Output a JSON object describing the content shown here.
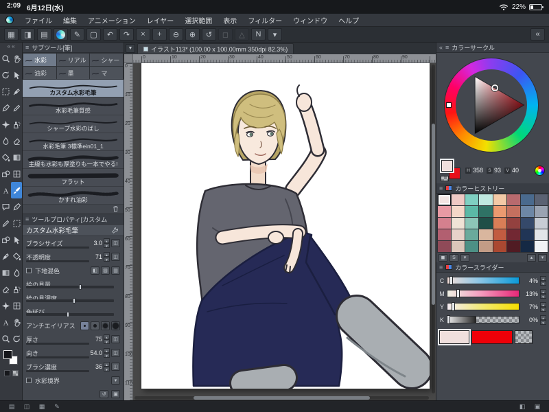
{
  "ui_glyphs": {
    "burger": "≡",
    "chevron": "«",
    "step_up": "▲",
    "step_down": "▼",
    "expand": "▾",
    "doc_menu": "▼"
  },
  "status_bar": {
    "time": "2:09",
    "date": "6月12日(水)",
    "battery": "22%"
  },
  "menu_bar": {
    "items": [
      "ファイル",
      "編集",
      "アニメーション",
      "レイヤー",
      "選択範囲",
      "表示",
      "フィルター",
      "ウィンドウ",
      "ヘルプ"
    ]
  },
  "toolbar": {
    "icons": [
      {
        "name": "workspace-grid-icon",
        "glyph": "▦"
      },
      {
        "name": "split-view-icon",
        "glyph": "◨"
      },
      {
        "name": "palette-dock-icon",
        "glyph": "▤"
      },
      {
        "name": "current-tool-swirl-icon",
        "glyph": "",
        "swirl": true
      },
      {
        "name": "stabilizer-icon",
        "glyph": "✎"
      },
      {
        "name": "new-page-icon",
        "glyph": "▢"
      },
      {
        "name": "undo-icon",
        "glyph": "↶"
      },
      {
        "name": "redo-icon",
        "glyph": "↷"
      },
      {
        "name": "clear-icon",
        "glyph": "×"
      },
      {
        "name": "move-canvas-icon",
        "glyph": "+"
      },
      {
        "name": "zoom-out-icon",
        "glyph": "⊖"
      },
      {
        "name": "zoom-in-icon",
        "glyph": "⊕"
      },
      {
        "name": "reset-rotate-icon",
        "glyph": "↺"
      },
      {
        "name": "transform-icon",
        "glyph": "◻",
        "disabled": true
      },
      {
        "name": "snap-icon",
        "glyph": "△",
        "disabled": true
      },
      {
        "name": "pressure-curve-icon",
        "glyph": "N"
      },
      {
        "name": "toolbar-menu-icon",
        "glyph": "▾"
      },
      {
        "name": "collapse-right-icon",
        "glyph": "«",
        "last": true
      }
    ]
  },
  "tools": {
    "chevron": "« «",
    "cells": [
      {
        "icon": "magnifier",
        "name": "zoom-tool"
      },
      {
        "icon": "hand",
        "name": "move-tool"
      },
      {
        "icon": "rotate",
        "name": "rotate-tool"
      },
      {
        "icon": "cursor",
        "name": "operation-tool"
      },
      {
        "icon": "lasso",
        "name": "selection-tool"
      },
      {
        "icon": "eyedropper",
        "name": "eyedropper-tool"
      },
      {
        "icon": "pen",
        "name": "pen-tool"
      },
      {
        "icon": "pencil",
        "name": "pencil-tool"
      },
      {
        "icon": "decoration",
        "name": "decoration-tool"
      },
      {
        "icon": "airbrush",
        "name": "airbrush-tool"
      },
      {
        "icon": "blend",
        "name": "blend-tool"
      },
      {
        "icon": "eraser",
        "name": "eraser-tool"
      },
      {
        "icon": "bucket",
        "name": "fill-tool"
      },
      {
        "icon": "gradient",
        "name": "gradient-tool"
      },
      {
        "icon": "shape",
        "name": "figure-tool"
      },
      {
        "icon": "frame",
        "name": "frame-tool"
      },
      {
        "icon": "text",
        "name": "text-tool"
      },
      {
        "icon": "brush",
        "name": "brush-tool",
        "selected": true
      },
      {
        "icon": "balloon",
        "name": "balloon-tool"
      },
      {
        "icon": "pen",
        "name": "line-correction-tool"
      },
      {
        "icon": "pencil",
        "name": "crayon-tool"
      },
      {
        "icon": "lasso",
        "name": "polyline-selection-tool"
      },
      {
        "icon": "shape",
        "name": "ruler-tool"
      },
      {
        "icon": "cursor",
        "name": "object-tool"
      },
      {
        "icon": "eyedropper",
        "name": "color-sample-tool"
      },
      {
        "icon": "bucket",
        "name": "close-fill-tool"
      },
      {
        "icon": "gradient",
        "name": "contour-gradient-tool"
      },
      {
        "icon": "blend",
        "name": "liquify-tool"
      },
      {
        "icon": "eraser",
        "name": "kneaded-eraser-tool"
      },
      {
        "icon": "airbrush",
        "name": "spray-tool"
      },
      {
        "icon": "decoration",
        "name": "effect-tool"
      },
      {
        "icon": "frame",
        "name": "grid-tool"
      },
      {
        "icon": "text",
        "name": "balloon-text-tool"
      },
      {
        "icon": "hand",
        "name": "pan-tool"
      },
      {
        "icon": "magnifier",
        "name": "loupe-tool"
      },
      {
        "icon": "rotate",
        "name": "spin-tool"
      }
    ]
  },
  "subtool": {
    "title": "サブツール[筆]",
    "tabs": [
      {
        "label": "水彩",
        "active": true
      },
      {
        "label": "リアル",
        "active": false
      },
      {
        "label": "シャー",
        "active": false
      },
      {
        "label": "油彩",
        "active": false
      },
      {
        "label": "墨",
        "active": false
      },
      {
        "label": "マ",
        "active": false
      }
    ],
    "brushes": [
      {
        "name": "カスタム水彩毛筆",
        "stroke": "wave",
        "selected": true
      },
      {
        "name": "水彩毛筆質感",
        "stroke": "texture",
        "selected": false
      },
      {
        "name": "シャープ水彩のばし",
        "stroke": "sharp",
        "selected": false
      },
      {
        "name": "水彩毛筆 3標準ein01_1",
        "stroke": "standard",
        "selected": false
      },
      {
        "name": "主線も水彩も厚塗りも一本でやる!",
        "stroke": "thick",
        "selected": false
      },
      {
        "name": "フラット",
        "stroke": "flat",
        "selected": false
      },
      {
        "name": "かすれ油彩",
        "stroke": "dry",
        "selected": false
      }
    ]
  },
  "tool_property": {
    "title": "ツールプロパティ[カスタム",
    "brush_name": "カスタム水彩毛筆",
    "params": [
      {
        "name": "brush-size",
        "label": "ブラシサイズ",
        "type": "number",
        "value": "3.0",
        "fill": 6
      },
      {
        "name": "opacity",
        "label": "不透明度",
        "type": "number",
        "value": "71",
        "fill": 71
      },
      {
        "name": "base-color-mix",
        "label": "下地混色",
        "type": "chips",
        "checkbox": true
      },
      {
        "name": "paint-amount",
        "label": "絵の具量",
        "type": "slider",
        "fill": 62
      },
      {
        "name": "paint-density",
        "label": "絵の具濃度",
        "type": "slider",
        "fill": 55
      },
      {
        "name": "color-stretch",
        "label": "色延び",
        "type": "slider",
        "fill": 48
      },
      {
        "name": "anti-aliasing",
        "label": "アンチエイリアス",
        "type": "circles"
      },
      {
        "name": "thickness",
        "label": "厚さ",
        "type": "number",
        "value": "75",
        "fill": 75
      },
      {
        "name": "direction",
        "label": "向き",
        "type": "number",
        "value": "54.0",
        "fill": 15
      },
      {
        "name": "brush-density",
        "label": "ブラシ濃度",
        "type": "number",
        "value": "36",
        "fill": 36
      },
      {
        "name": "watercolor-edge",
        "label": "水彩境界",
        "type": "expand",
        "checkbox": true
      }
    ]
  },
  "document": {
    "tab_title": "イラスト113* (100.00 x 100.00mm 350dpi 82.3%)",
    "h_ruler": [
      "0",
      "10",
      "20",
      "30",
      "40",
      "50",
      "60",
      "70",
      "80",
      "90"
    ],
    "v_ruler": [
      "0",
      "10",
      "20",
      "30",
      "40",
      "50",
      "60",
      "70",
      "80",
      "90",
      "100",
      "110"
    ]
  },
  "color_circle": {
    "title": "カラーサークル",
    "hue_label": "H",
    "hue": "358",
    "sat_label": "S",
    "sat": "93",
    "val_label": "V",
    "val": "40",
    "main_color": "#f0dfdd",
    "sub_color": "#e8101a"
  },
  "color_history": {
    "title": "カラーヒストリー",
    "colors": [
      [
        "#f2e4e2",
        "#efc9c4",
        "#7fd0c2",
        "#bfe8e0",
        "#f3c9a6",
        "#b86a6e",
        "#4a6a8e",
        "#5b6273"
      ],
      [
        "#e89aa4",
        "#f4d7c8",
        "#5bb9a6",
        "#2f7265",
        "#eb9a70",
        "#c4705f",
        "#6d87a6",
        "#9aa3b2"
      ],
      [
        "#d4808e",
        "#efe3d6",
        "#8cc6b8",
        "#1f4f47",
        "#d97e57",
        "#93413f",
        "#35496a",
        "#c7ccd4"
      ],
      [
        "#b25f70",
        "#e7d2c9",
        "#6aaa9c",
        "#d9b69e",
        "#c25c41",
        "#722833",
        "#203556",
        "#e2e5e9"
      ],
      [
        "#8f4a58",
        "#dcc6ba",
        "#4d9085",
        "#c29c86",
        "#aa4831",
        "#501b23",
        "#152944",
        "#f1f3f5"
      ]
    ],
    "footer_left": [
      {
        "name": "add-history-color-icon",
        "glyph": "◼"
      },
      {
        "name": "register-color-icon",
        "glyph": "S"
      },
      {
        "name": "history-menu-icon",
        "glyph": "▾"
      }
    ],
    "footer_right": [
      {
        "name": "scroll-up-icon",
        "glyph": "▴"
      },
      {
        "name": "scroll-down-icon",
        "glyph": "▾"
      }
    ]
  },
  "color_slider": {
    "title": "カラースライダー",
    "sliders": [
      {
        "ch": "C",
        "value": "4%",
        "pos": 4
      },
      {
        "ch": "M",
        "value": "13%",
        "pos": 13
      },
      {
        "ch": "Y",
        "value": "7%",
        "pos": 7
      },
      {
        "ch": "K",
        "value": "0%",
        "pos": 0
      }
    ],
    "current_color": "#f0dfdd",
    "sub_color": "#ee0008"
  },
  "bottom_bar": {
    "left_icons": [
      {
        "name": "toggle-tool-panel-icon",
        "glyph": "▤"
      },
      {
        "name": "toggle-palette-icon",
        "glyph": "◫"
      },
      {
        "name": "toggle-timeline-icon",
        "glyph": "▦"
      },
      {
        "name": "edge-keyboard-icon",
        "glyph": "✎"
      }
    ],
    "right_icons": [
      {
        "name": "toggle-color-panel-icon",
        "glyph": "◧"
      },
      {
        "name": "toggle-material-panel-icon",
        "glyph": "▣"
      }
    ]
  }
}
